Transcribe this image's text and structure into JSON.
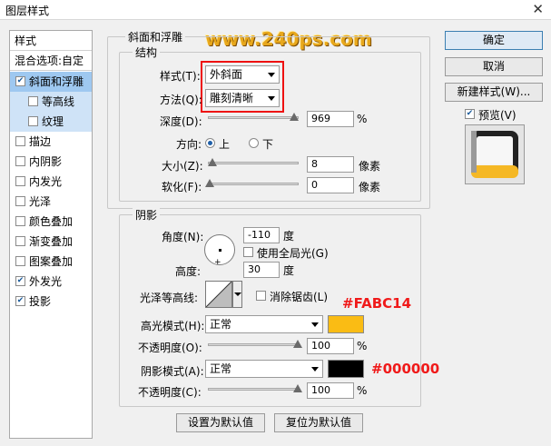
{
  "window": {
    "title": "图层样式",
    "close_glyph": "✕"
  },
  "watermark": "www.240ps.com",
  "styles_panel": {
    "header": "样式",
    "blend_options": "混合选项:自定",
    "items": [
      {
        "label": "斜面和浮雕",
        "checked": true,
        "selected": true,
        "sub": false
      },
      {
        "label": "等高线",
        "checked": false,
        "selected": false,
        "sub": true
      },
      {
        "label": "纹理",
        "checked": false,
        "selected": false,
        "sub": true
      },
      {
        "label": "描边",
        "checked": false,
        "selected": false,
        "sub": false
      },
      {
        "label": "内阴影",
        "checked": false,
        "selected": false,
        "sub": false
      },
      {
        "label": "内发光",
        "checked": false,
        "selected": false,
        "sub": false
      },
      {
        "label": "光泽",
        "checked": false,
        "selected": false,
        "sub": false
      },
      {
        "label": "颜色叠加",
        "checked": false,
        "selected": false,
        "sub": false
      },
      {
        "label": "渐变叠加",
        "checked": false,
        "selected": false,
        "sub": false
      },
      {
        "label": "图案叠加",
        "checked": false,
        "selected": false,
        "sub": false
      },
      {
        "label": "外发光",
        "checked": true,
        "selected": false,
        "sub": false
      },
      {
        "label": "投影",
        "checked": true,
        "selected": false,
        "sub": false
      }
    ]
  },
  "bevel": {
    "group_title": "斜面和浮雕",
    "structure_title": "结构",
    "style_label": "样式(T):",
    "style_value": "外斜面",
    "technique_label": "方法(Q):",
    "technique_value": "雕刻清晰",
    "depth_label": "深度(D):",
    "depth_value": "969",
    "depth_unit": "%",
    "depth_level": 0.97,
    "direction_label": "方向:",
    "direction_up": "上",
    "direction_down": "下",
    "size_label": "大小(Z):",
    "size_value": "8",
    "size_unit": "像素",
    "size_level": 0.03,
    "soften_label": "软化(F):",
    "soften_value": "0",
    "soften_unit": "像素",
    "soften_level": 0.0
  },
  "shading": {
    "group_title": "阴影",
    "angle_label": "角度(N):",
    "angle_value": "-110",
    "angle_unit": "度",
    "global_light_label": "使用全局光(G)",
    "altitude_label": "高度:",
    "altitude_value": "30",
    "altitude_unit": "度",
    "gloss_label": "光泽等高线:",
    "antialias_label": "消除锯齿(L)",
    "highlight_mode_label": "高光模式(H):",
    "highlight_mode_value": "正常",
    "highlight_color": "#FABC14",
    "highlight_opacity_label": "不透明度(O):",
    "highlight_opacity_value": "100",
    "highlight_opacity_unit": "%",
    "shadow_mode_label": "阴影模式(A):",
    "shadow_mode_value": "正常",
    "shadow_color": "#000000",
    "shadow_opacity_label": "不透明度(C):",
    "shadow_opacity_value": "100",
    "shadow_opacity_unit": "%"
  },
  "annotations": {
    "highlight": "#FABC14",
    "shadow": "#000000"
  },
  "footer": {
    "make_default": "设置为默认值",
    "reset_default": "复位为默认值"
  },
  "right": {
    "ok": "确定",
    "cancel": "取消",
    "new_style": "新建样式(W)...",
    "preview_label": "预览(V)",
    "preview_checked": true
  }
}
